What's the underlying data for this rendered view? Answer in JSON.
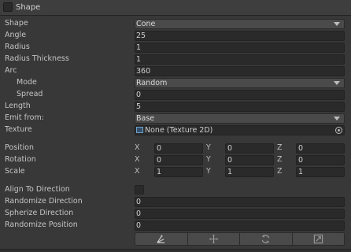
{
  "header": {
    "title": "Shape"
  },
  "rows": {
    "shape": {
      "label": "Shape",
      "value": "Cone"
    },
    "angle": {
      "label": "Angle",
      "value": "25"
    },
    "radius": {
      "label": "Radius",
      "value": "1"
    },
    "radius_thickness": {
      "label": "Radius Thickness",
      "value": "1"
    },
    "arc": {
      "label": "Arc",
      "value": "360"
    },
    "mode": {
      "label": "Mode",
      "value": "Random"
    },
    "spread": {
      "label": "Spread",
      "value": "0"
    },
    "length": {
      "label": "Length",
      "value": "5"
    },
    "emit_from": {
      "label": "Emit from:",
      "value": "Base"
    },
    "texture": {
      "label": "Texture",
      "value": "None (Texture 2D)"
    },
    "position": {
      "label": "Position",
      "x": "0",
      "y": "0",
      "z": "0"
    },
    "rotation": {
      "label": "Rotation",
      "x": "0",
      "y": "0",
      "z": "0"
    },
    "scale": {
      "label": "Scale",
      "x": "1",
      "y": "1",
      "z": "1"
    },
    "align_to_direction": {
      "label": "Align To Direction",
      "checked": false
    },
    "randomize_direction": {
      "label": "Randomize Direction",
      "value": "0"
    },
    "spherize_direction": {
      "label": "Spherize Direction",
      "value": "0"
    },
    "randomize_position": {
      "label": "Randomize Position",
      "value": "0"
    }
  },
  "axes": {
    "x": "X",
    "y": "Y",
    "z": "Z"
  },
  "toolbar": {
    "buttons": [
      {
        "icon": "edit-shape-icon"
      },
      {
        "icon": "move-icon"
      },
      {
        "icon": "rotate-icon"
      },
      {
        "icon": "scale-icon"
      }
    ]
  },
  "colors": {
    "background": "#383838",
    "field": "#2a2a2a",
    "dropdown": "#4a4a4a",
    "text": "#c4c4c4"
  }
}
